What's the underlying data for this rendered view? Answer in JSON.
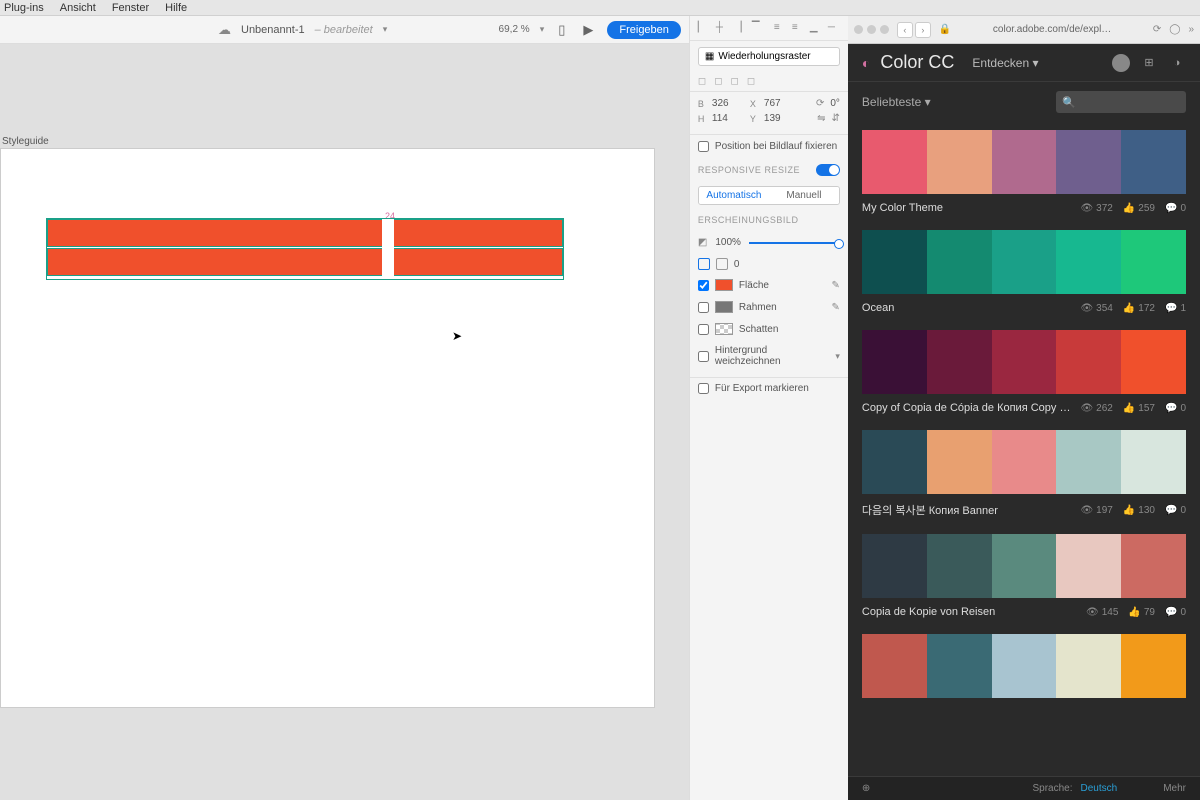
{
  "menubar": [
    "Plug-ins",
    "Ansicht",
    "Fenster",
    "Hilfe"
  ],
  "toolbar": {
    "doc_title": "Unbenannt-1",
    "doc_state": "– bearbeitet",
    "zoom": "69,2 %",
    "share": "Freigeben"
  },
  "canvas": {
    "page_label": "Styleguide",
    "gap_value": "24"
  },
  "inspector": {
    "repeat_grid": "Wiederholungsraster",
    "transform": {
      "b": "326",
      "h": "114",
      "x": "767",
      "y": "139",
      "rot": "0°"
    },
    "lock_scroll": "Position bei Bildlauf fixieren",
    "responsive": "RESPONSIVE RESIZE",
    "auto": "Automatisch",
    "manual": "Manuell",
    "appearance": "ERSCHEINUNGSBILD",
    "opacity": "100%",
    "corner": "0",
    "fill": "Fläche",
    "border": "Rahmen",
    "shadow": "Schatten",
    "blur": "Hintergrund weichzeichnen",
    "export": "Für Export markieren"
  },
  "browser": {
    "url": "color.adobe.com/de/expl…"
  },
  "cc": {
    "title": "Color CC",
    "discover": "Entdecken",
    "popular": "Beliebteste",
    "search_placeholder": "",
    "footer_lang_label": "Sprache:",
    "footer_lang": "Deutsch",
    "footer_more": "Mehr"
  },
  "themes": [
    {
      "name": "My Color Theme",
      "colors": [
        "#e85a6e",
        "#e8a07e",
        "#b06a8e",
        "#6f5f8e",
        "#3f5f86"
      ],
      "views": "372",
      "likes": "259",
      "comments": "0"
    },
    {
      "name": "Ocean",
      "colors": [
        "#0e4f4f",
        "#148a70",
        "#1aa088",
        "#17b890",
        "#1ec87a"
      ],
      "views": "354",
      "likes": "172",
      "comments": "1"
    },
    {
      "name": "Copy of Copia de Cópia de Копия Copy …",
      "colors": [
        "#3a1036",
        "#6a1a3a",
        "#9a2740",
        "#c83a3a",
        "#f0502c"
      ],
      "views": "262",
      "likes": "157",
      "comments": "0"
    },
    {
      "name": "다음의 복사본 Копия Banner",
      "colors": [
        "#2a4a56",
        "#e8a070",
        "#e88a8a",
        "#a8c8c4",
        "#d8e6de"
      ],
      "views": "197",
      "likes": "130",
      "comments": "0"
    },
    {
      "name": "Copia de Kopie von Reisen",
      "colors": [
        "#2e3a44",
        "#3a5a5a",
        "#5a8a7e",
        "#e8c8c0",
        "#cc6a62"
      ],
      "views": "145",
      "likes": "79",
      "comments": "0"
    },
    {
      "name": "",
      "colors": [
        "#c0584e",
        "#3a6a74",
        "#a8c4d0",
        "#e4e4cc",
        "#f29a1a"
      ],
      "views": "",
      "likes": "",
      "comments": ""
    }
  ]
}
